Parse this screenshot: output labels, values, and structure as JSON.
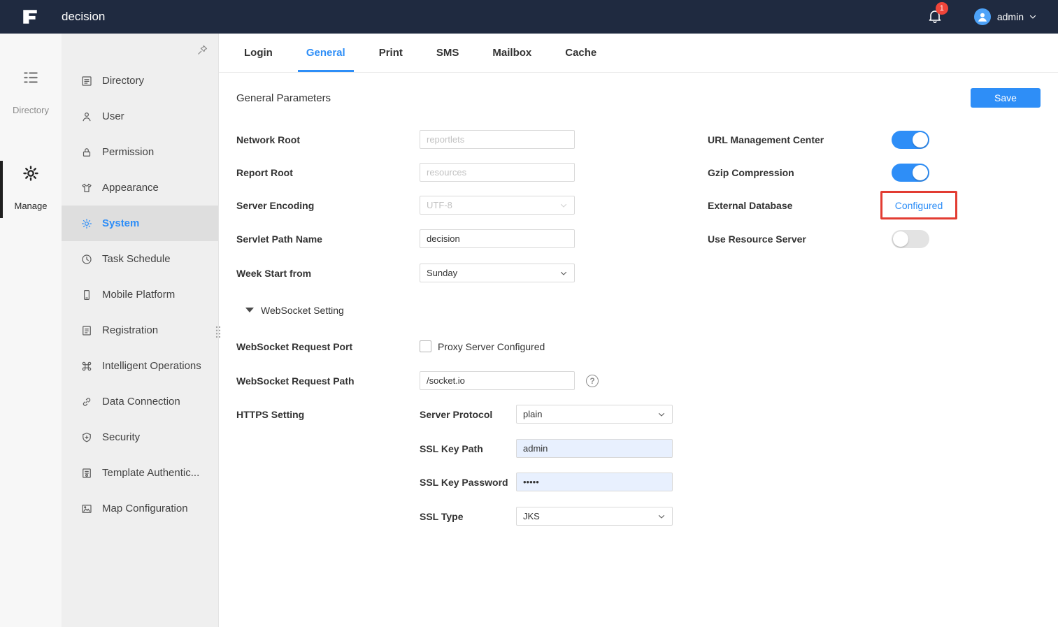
{
  "colors": {
    "accent": "#2E8EF7",
    "topbar": "#1F2A40",
    "badge_red": "#F0453A",
    "highlight_red": "#E23C32",
    "toggle_on": "#2E8EF7"
  },
  "icons": {
    "help_glyph": "?"
  },
  "topbar": {
    "app_title": "decision",
    "notification_count": "1",
    "user_name": "admin"
  },
  "left_rail": {
    "items": [
      {
        "label": "Directory",
        "active": false
      },
      {
        "label": "Manage",
        "active": true
      }
    ]
  },
  "sidebar": {
    "items": [
      {
        "label": "Directory",
        "active": false
      },
      {
        "label": "User",
        "active": false
      },
      {
        "label": "Permission",
        "active": false
      },
      {
        "label": "Appearance",
        "active": false
      },
      {
        "label": "System",
        "active": true
      },
      {
        "label": "Task Schedule",
        "active": false
      },
      {
        "label": "Mobile Platform",
        "active": false
      },
      {
        "label": "Registration",
        "active": false
      },
      {
        "label": "Intelligent Operations",
        "active": false
      },
      {
        "label": "Data Connection",
        "active": false
      },
      {
        "label": "Security",
        "active": false
      },
      {
        "label": "Template Authentic...",
        "active": false
      },
      {
        "label": "Map Configuration",
        "active": false
      }
    ]
  },
  "tabs": {
    "items": [
      {
        "label": "Login",
        "active": false
      },
      {
        "label": "General",
        "active": true
      },
      {
        "label": "Print",
        "active": false
      },
      {
        "label": "SMS",
        "active": false
      },
      {
        "label": "Mailbox",
        "active": false
      },
      {
        "label": "Cache",
        "active": false
      }
    ]
  },
  "general": {
    "section_title": "General Parameters",
    "save_label": "Save",
    "network_root": {
      "label": "Network Root",
      "placeholder": "reportlets",
      "value": ""
    },
    "report_root": {
      "label": "Report Root",
      "placeholder": "resources",
      "value": ""
    },
    "server_encoding": {
      "label": "Server Encoding",
      "value": "UTF-8",
      "disabled": true
    },
    "servlet_path": {
      "label": "Servlet Path Name",
      "value": "decision"
    },
    "week_start": {
      "label": "Week Start from",
      "value": "Sunday"
    },
    "websocket_section_title": "WebSocket Setting",
    "ws_request_port": {
      "label": "WebSocket Request Port",
      "checkbox_label": "Proxy Server Configured",
      "checked": false
    },
    "ws_request_path": {
      "label": "WebSocket Request Path",
      "value": "/socket.io"
    },
    "https_setting": {
      "label": "HTTPS Setting",
      "server_protocol": {
        "label": "Server Protocol",
        "value": "plain"
      },
      "ssl_key_path": {
        "label": "SSL Key Path",
        "value": "admin"
      },
      "ssl_key_password": {
        "label": "SSL Key Password",
        "value": "•••••"
      },
      "ssl_type": {
        "label": "SSL Type",
        "value": "JKS"
      }
    },
    "url_management": {
      "label": "URL Management Center",
      "enabled": true
    },
    "gzip": {
      "label": "Gzip Compression",
      "enabled": true
    },
    "external_database": {
      "label": "External Database",
      "link_label": "Configured"
    },
    "resource_server": {
      "label": "Use Resource Server",
      "enabled": false
    }
  }
}
